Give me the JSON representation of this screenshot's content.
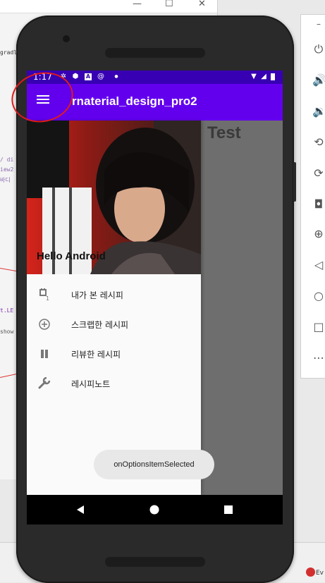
{
  "desktop": {
    "bg_window": {
      "controls": [
        "—",
        "☐",
        "✕"
      ],
      "code_fragments": [
        "gradle",
        "/ di",
        "iew2",
        "바디",
        "t.LE",
        "show"
      ]
    },
    "emulator_toolbar": {
      "minimize_label": "–",
      "icons": [
        "power-icon",
        "volume-up-icon",
        "volume-down-icon",
        "rotate-left-icon",
        "rotate-right-icon",
        "camera-icon",
        "zoom-icon",
        "back-icon",
        "home-icon",
        "overview-icon",
        "more-icon"
      ]
    },
    "taskbar": {
      "fragment": "Ev"
    }
  },
  "phone": {
    "statusbar": {
      "time": "1:17",
      "bg_color": "#3700b3"
    },
    "appbar": {
      "title": "rnaterial_design_pro2",
      "bg_color": "#6200ee"
    },
    "content": {
      "text": "Test"
    },
    "drawer": {
      "header_title": "Hello Android",
      "items": [
        {
          "icon": "recipe-viewed-icon",
          "label": "내가 본 레시피"
        },
        {
          "icon": "add-circle-icon",
          "label": "스크랩한 레시피"
        },
        {
          "icon": "pause-icon",
          "label": "리뷰한 레시피"
        },
        {
          "icon": "wrench-icon",
          "label": "레시피노트"
        }
      ]
    },
    "toast": "onOptionsItemSelected",
    "navbar": {
      "buttons": [
        "back-button",
        "home-button",
        "recents-button"
      ]
    }
  }
}
